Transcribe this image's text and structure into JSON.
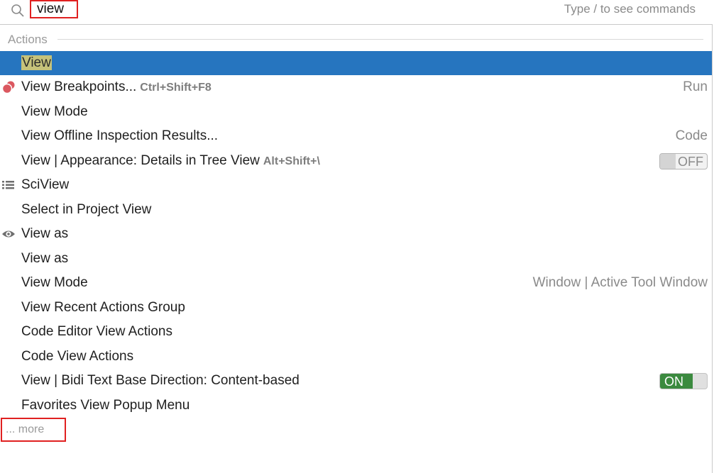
{
  "search": {
    "value": "view",
    "hint": "Type / to see commands"
  },
  "section": {
    "label": "Actions"
  },
  "rows": [
    {
      "name": "View",
      "shortcut": "",
      "right": ""
    },
    {
      "name": "View Breakpoints...",
      "shortcut": "Ctrl+Shift+F8",
      "right": "Run",
      "icon": "breakpoints-icon"
    },
    {
      "name": "View Mode",
      "shortcut": "",
      "right": ""
    },
    {
      "name": "View Offline Inspection Results...",
      "shortcut": "",
      "right": "Code"
    },
    {
      "name": "View | Appearance: Details in Tree View",
      "shortcut": "Alt+Shift+\\",
      "toggle": "OFF"
    },
    {
      "name": "SciView",
      "shortcut": "",
      "right": "",
      "icon": "sciview-icon"
    },
    {
      "name": "Select in Project View",
      "shortcut": "",
      "right": ""
    },
    {
      "name": "View as",
      "shortcut": "",
      "right": "",
      "icon": "eye-icon"
    },
    {
      "name": "View as",
      "shortcut": "",
      "right": ""
    },
    {
      "name": "View Mode",
      "shortcut": "",
      "right": "Window | Active Tool Window"
    },
    {
      "name": "View Recent Actions Group",
      "shortcut": "",
      "right": ""
    },
    {
      "name": "Code Editor View Actions",
      "shortcut": "",
      "right": ""
    },
    {
      "name": "Code View Actions",
      "shortcut": "",
      "right": ""
    },
    {
      "name": "View | Bidi Text Base Direction: Content-based",
      "shortcut": "",
      "toggle": "ON"
    },
    {
      "name": "Favorites View Popup Menu",
      "shortcut": "",
      "right": ""
    }
  ],
  "more": {
    "label": "... more"
  },
  "colors": {
    "selection": "#2675bf",
    "toggle_on": "#3b8a3f",
    "annotation_red": "#e02020",
    "breakpoint_red": "#db5860"
  }
}
